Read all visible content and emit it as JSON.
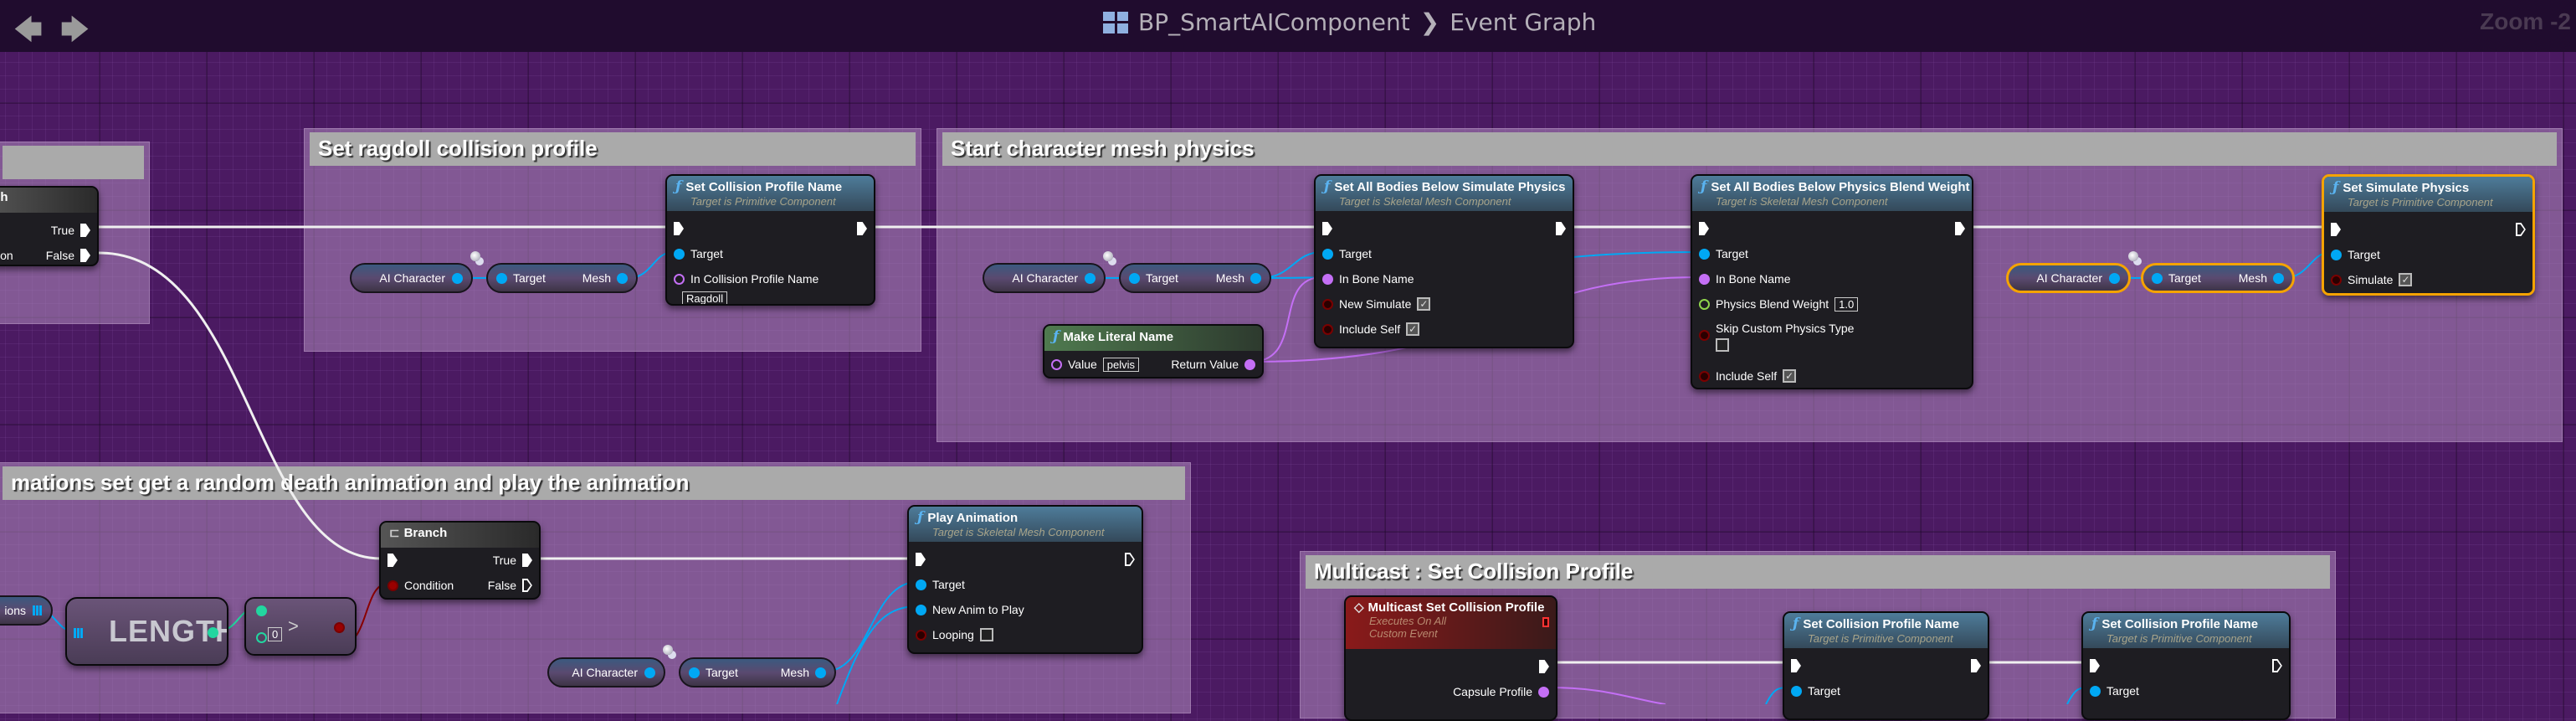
{
  "header": {
    "title": "BP_SmartAIComponent",
    "separator": "❯",
    "graph": "Event Graph",
    "zoom": "Zoom -2",
    "back": "🡄",
    "forward": "🡆"
  },
  "comments": {
    "ragdoll": "Set ragdoll collision profile",
    "physics": "Start character mesh physics",
    "death": "mations set get a random death animation and play the animation",
    "multicast": "Multicast : Set Collision Profile"
  },
  "common": {
    "target": "Target",
    "mesh": "Mesh",
    "ai_character": "AI Character",
    "fn": "ƒ",
    "check": "✓"
  },
  "branch_left": {
    "title": "ch",
    "true": "True",
    "false": "False",
    "condition": "ition"
  },
  "set_collision": {
    "title": "Set Collision Profile Name",
    "subtitle": "Target is Primitive Component",
    "pin_profile": "In Collision Profile Name",
    "profile_value": "Ragdoll"
  },
  "simulate_below": {
    "title": "Set All Bodies Below Simulate Physics",
    "subtitle": "Target is Skeletal Mesh Component",
    "in_bone": "In Bone Name",
    "new_simulate": "New Simulate",
    "include_self": "Include Self"
  },
  "blend_weight": {
    "title": "Set All Bodies Below Physics Blend Weight",
    "subtitle": "Target is Skeletal Mesh Component",
    "in_bone": "In Bone Name",
    "blend": "Physics Blend Weight",
    "blend_value": "1.0",
    "skip": "Skip Custom Physics Type",
    "include_self": "Include Self"
  },
  "literal_name": {
    "title": "Make Literal Name",
    "value_label": "Value",
    "value": "pelvis",
    "return": "Return Value"
  },
  "simulate_physics": {
    "title": "Set Simulate Physics",
    "subtitle": "Target is Primitive Component",
    "simulate": "Simulate"
  },
  "branch": {
    "title": "Branch",
    "true": "True",
    "false": "False",
    "condition": "Condition"
  },
  "animations_var": {
    "label": "ions"
  },
  "length": {
    "label": "LENGTH"
  },
  "compare": {
    "value": "0",
    "op": ">"
  },
  "play_animation": {
    "title": "Play Animation",
    "subtitle": "Target is Skeletal Mesh Component",
    "new_anim": "New Anim to Play",
    "looping": "Looping"
  },
  "multicast_event": {
    "title": "Multicast Set Collision Profile",
    "line1": "Executes On All",
    "line2": "Custom Event",
    "capsule": "Capsule Profile"
  },
  "set_collision_2": {
    "title": "Set Collision Profile Name",
    "subtitle": "Target is Primitive Component"
  },
  "set_collision_3": {
    "title": "Set Collision Profile Name",
    "subtitle": "Target is Primitive Component"
  }
}
